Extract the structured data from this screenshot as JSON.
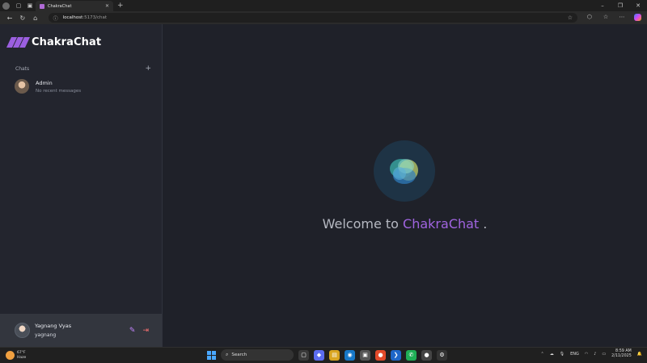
{
  "browser": {
    "tab_title": "ChakraChat",
    "url_host": "localhost",
    "url_path": ":5173/chat"
  },
  "sidebar": {
    "brand_name": "ChakraChat",
    "chats_label": "Chats",
    "chats": [
      {
        "name": "Admin",
        "preview": "No recent messages"
      }
    ],
    "profile": {
      "display_name": "Yagnang Vyas",
      "username": "yagnang"
    }
  },
  "main": {
    "welcome_prefix": "Welcome to",
    "welcome_brand": "ChakraChat",
    "welcome_suffix": "."
  },
  "taskbar": {
    "weather_temp": "67°F",
    "weather_cond": "Haze",
    "search_placeholder": "Search",
    "lang": "ENG",
    "time": "8:59 AM",
    "date": "2/11/2025"
  },
  "colors": {
    "accent": "#9b5fe0",
    "logout": "#f87171",
    "sidebar_bg": "#23252e",
    "main_bg": "#1f2129"
  }
}
